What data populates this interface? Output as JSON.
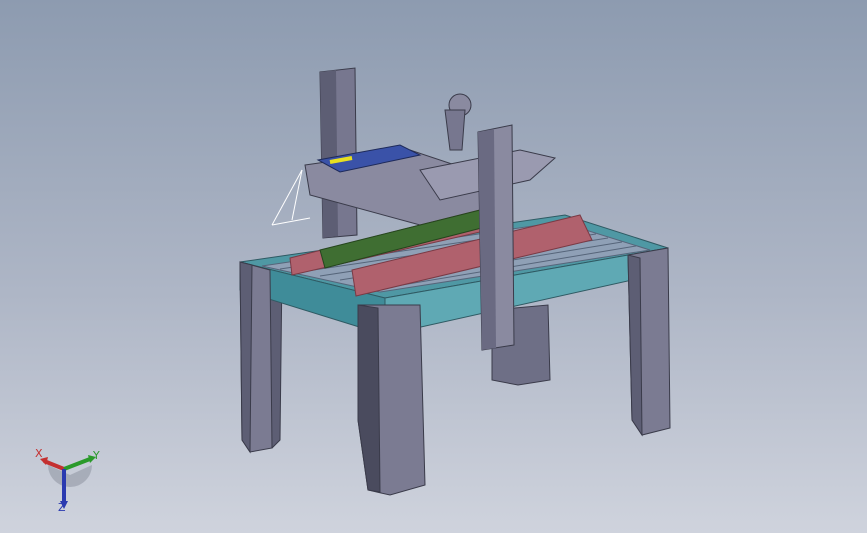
{
  "viewport": {
    "background_top": "#8d9bb0",
    "background_bottom": "#cfd3dd"
  },
  "colors": {
    "frame_gray": "#77778f",
    "frame_dark": "#4f5064",
    "leg_face": "#7b7b92",
    "leg_shadow": "#4a4b5e",
    "table_teal": "#3f8c99",
    "table_teal_light": "#5fa9b4",
    "roller": "#7d8ca3",
    "belt_red": "#b0616d",
    "belt_red_dark": "#8a4250",
    "rail_green": "#3f6e32",
    "cylinder_blue": "#3a52a8",
    "rod_yellow": "#e8e020"
  },
  "triad": {
    "x_label": "X",
    "y_label": "Y",
    "z_label": "Z",
    "x_color": "#c43030",
    "y_color": "#2a9a2a",
    "z_color": "#2a3ab0"
  }
}
